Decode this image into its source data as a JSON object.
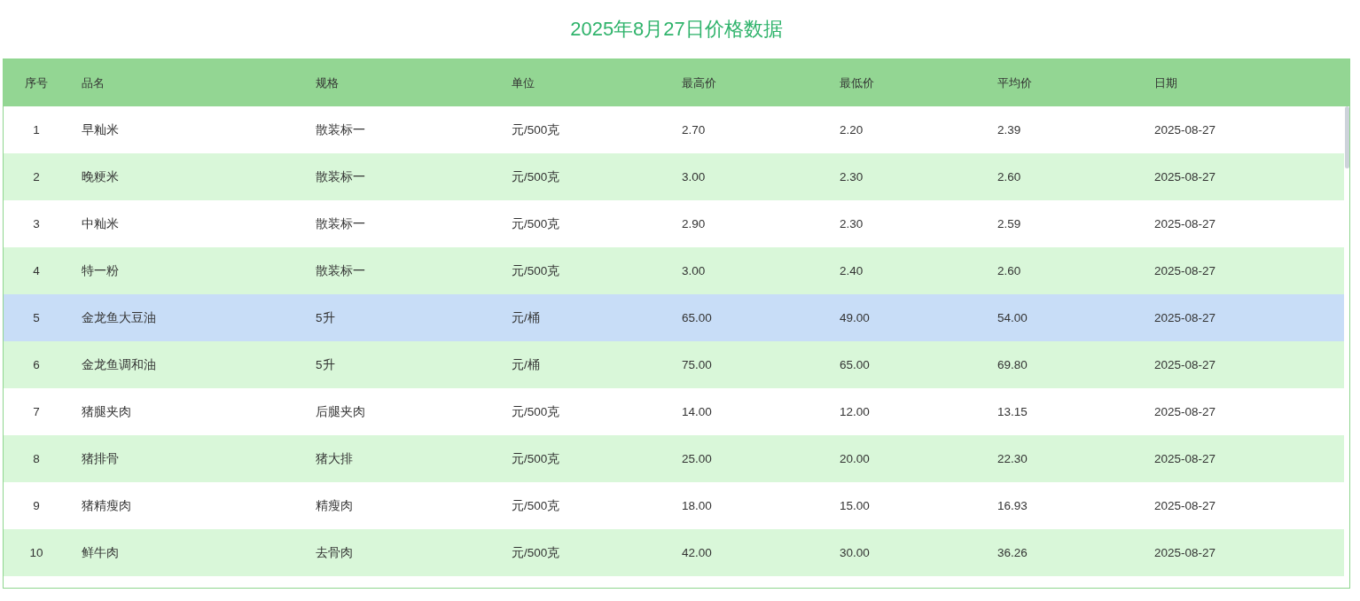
{
  "title": "2025年8月27日价格数据",
  "table": {
    "columns": [
      "序号",
      "品名",
      "规格",
      "单位",
      "最高价",
      "最低价",
      "平均价",
      "日期"
    ],
    "rows": [
      {
        "cells": [
          "1",
          "早籼米",
          "散装标一",
          "元/500克",
          "2.70",
          "2.20",
          "2.39",
          "2025-08-27"
        ],
        "selected": false
      },
      {
        "cells": [
          "2",
          "晚粳米",
          "散装标一",
          "元/500克",
          "3.00",
          "2.30",
          "2.60",
          "2025-08-27"
        ],
        "selected": false
      },
      {
        "cells": [
          "3",
          "中籼米",
          "散装标一",
          "元/500克",
          "2.90",
          "2.30",
          "2.59",
          "2025-08-27"
        ],
        "selected": false
      },
      {
        "cells": [
          "4",
          "特一粉",
          "散装标一",
          "元/500克",
          "3.00",
          "2.40",
          "2.60",
          "2025-08-27"
        ],
        "selected": false
      },
      {
        "cells": [
          "5",
          "金龙鱼大豆油",
          "5升",
          "元/桶",
          "65.00",
          "49.00",
          "54.00",
          "2025-08-27"
        ],
        "selected": true
      },
      {
        "cells": [
          "6",
          "金龙鱼调和油",
          "5升",
          "元/桶",
          "75.00",
          "65.00",
          "69.80",
          "2025-08-27"
        ],
        "selected": false
      },
      {
        "cells": [
          "7",
          "猪腿夹肉",
          "后腿夹肉",
          "元/500克",
          "14.00",
          "12.00",
          "13.15",
          "2025-08-27"
        ],
        "selected": false
      },
      {
        "cells": [
          "8",
          "猪排骨",
          "猪大排",
          "元/500克",
          "25.00",
          "20.00",
          "22.30",
          "2025-08-27"
        ],
        "selected": false
      },
      {
        "cells": [
          "9",
          "猪精瘦肉",
          "精瘦肉",
          "元/500克",
          "18.00",
          "15.00",
          "16.93",
          "2025-08-27"
        ],
        "selected": false
      },
      {
        "cells": [
          "10",
          "鲜牛肉",
          "去骨肉",
          "元/500克",
          "42.00",
          "30.00",
          "36.26",
          "2025-08-27"
        ],
        "selected": false
      }
    ]
  }
}
